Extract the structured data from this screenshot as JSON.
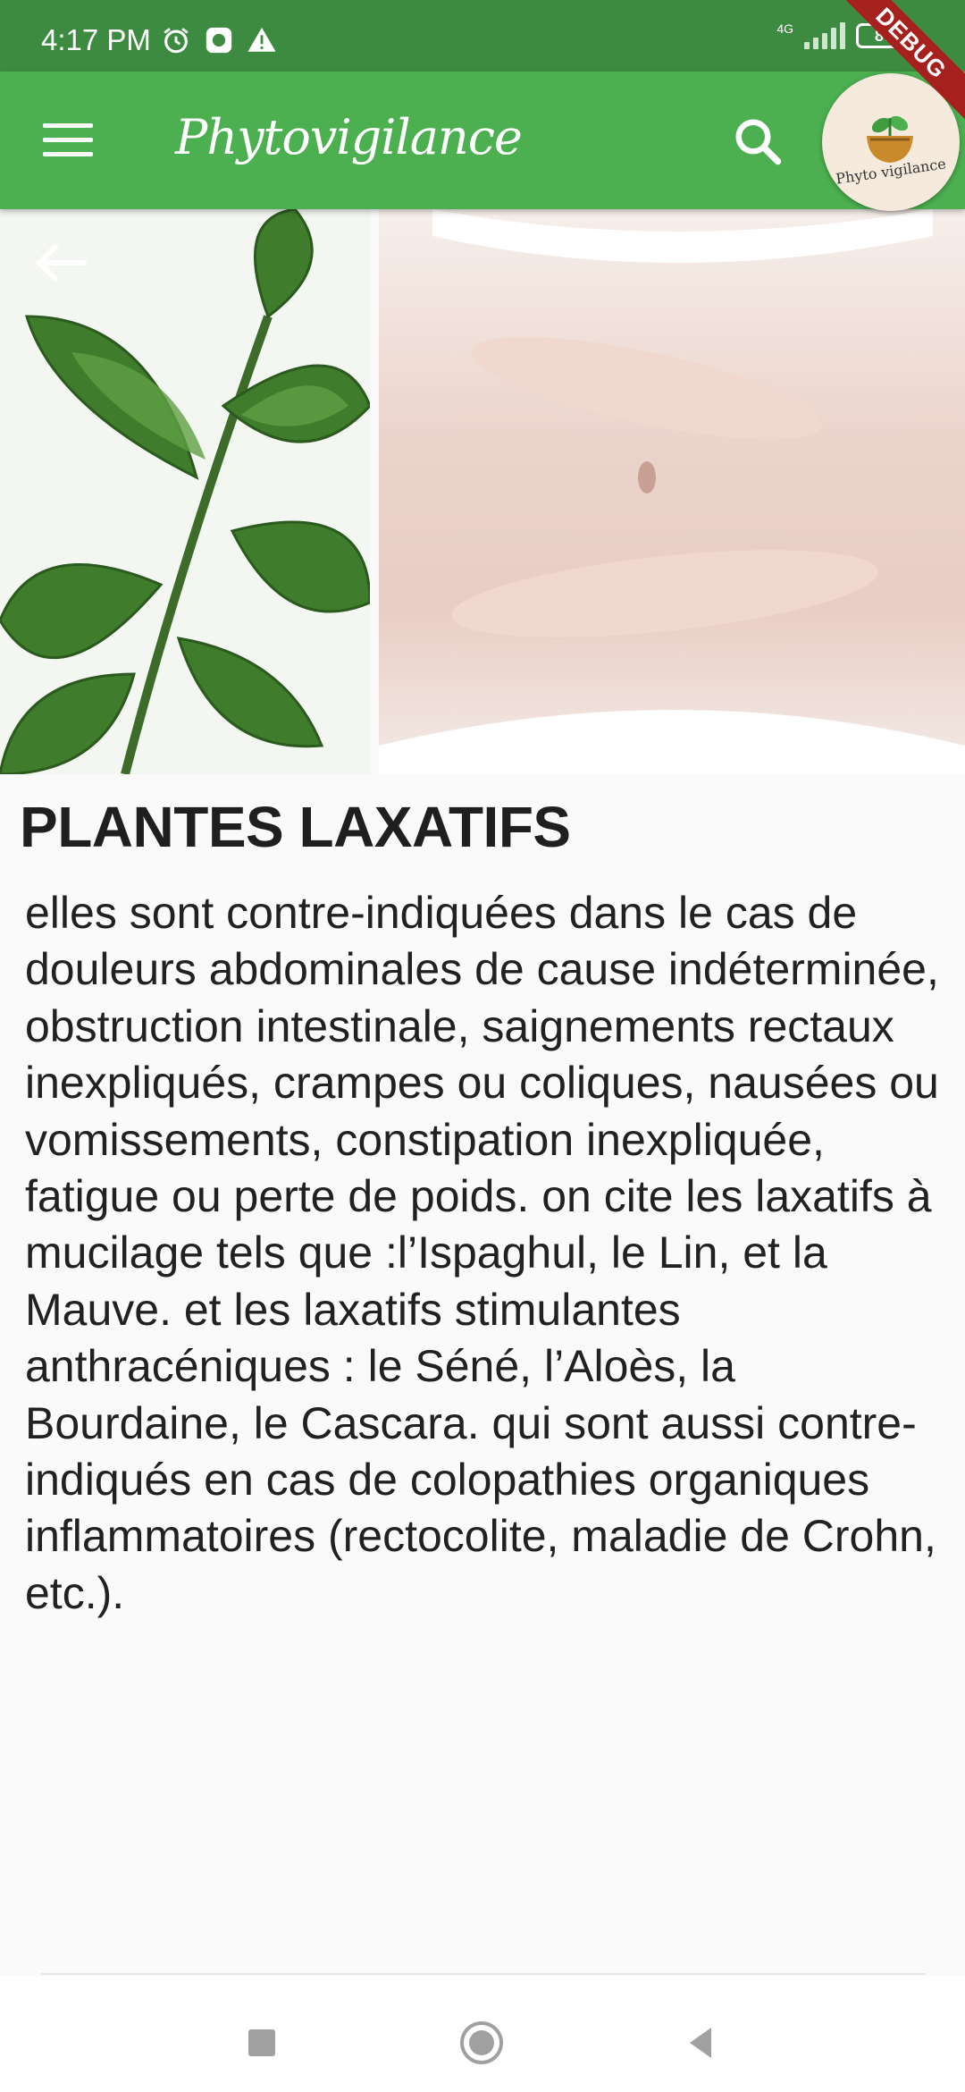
{
  "status_bar": {
    "time": "4:17 PM",
    "network": "4G",
    "battery": "87",
    "debug_banner": "DEBUG"
  },
  "app_bar": {
    "title": "Phytovigilance",
    "logo_text": "Phyto vigilance"
  },
  "article": {
    "title": "PLANTES LAXATIFS",
    "body": "elles sont contre-indiquées dans le cas de douleurs abdominales de cause indéterminée, obstruction intestinale, saignements rectaux inexpliqués, crampes ou coliques, nausées ou vomissements, constipation inexpliquée, fatigue ou perte de poids. on cite les laxatifs à mucilage tels que :l’Ispaghul, le Lin, et la Mauve. et les laxatifs stimulantes anthracéniques : le Séné, l’Aloès, la Bourdaine, le Cascara. qui sont aussi contre-indiqués en cas de colopathies organiques inflammatoires (rectocolite, maladie de Crohn, etc.)."
  },
  "colors": {
    "status_bar": "#3d8b40",
    "app_bar": "#4caf50",
    "background": "#fafafa",
    "debug_ribbon": "#a6201d"
  },
  "icons": [
    "menu-icon",
    "search-icon",
    "back-arrow-icon",
    "alarm-icon",
    "warning-icon",
    "square-nav-icon",
    "circle-nav-icon",
    "triangle-nav-icon"
  ]
}
